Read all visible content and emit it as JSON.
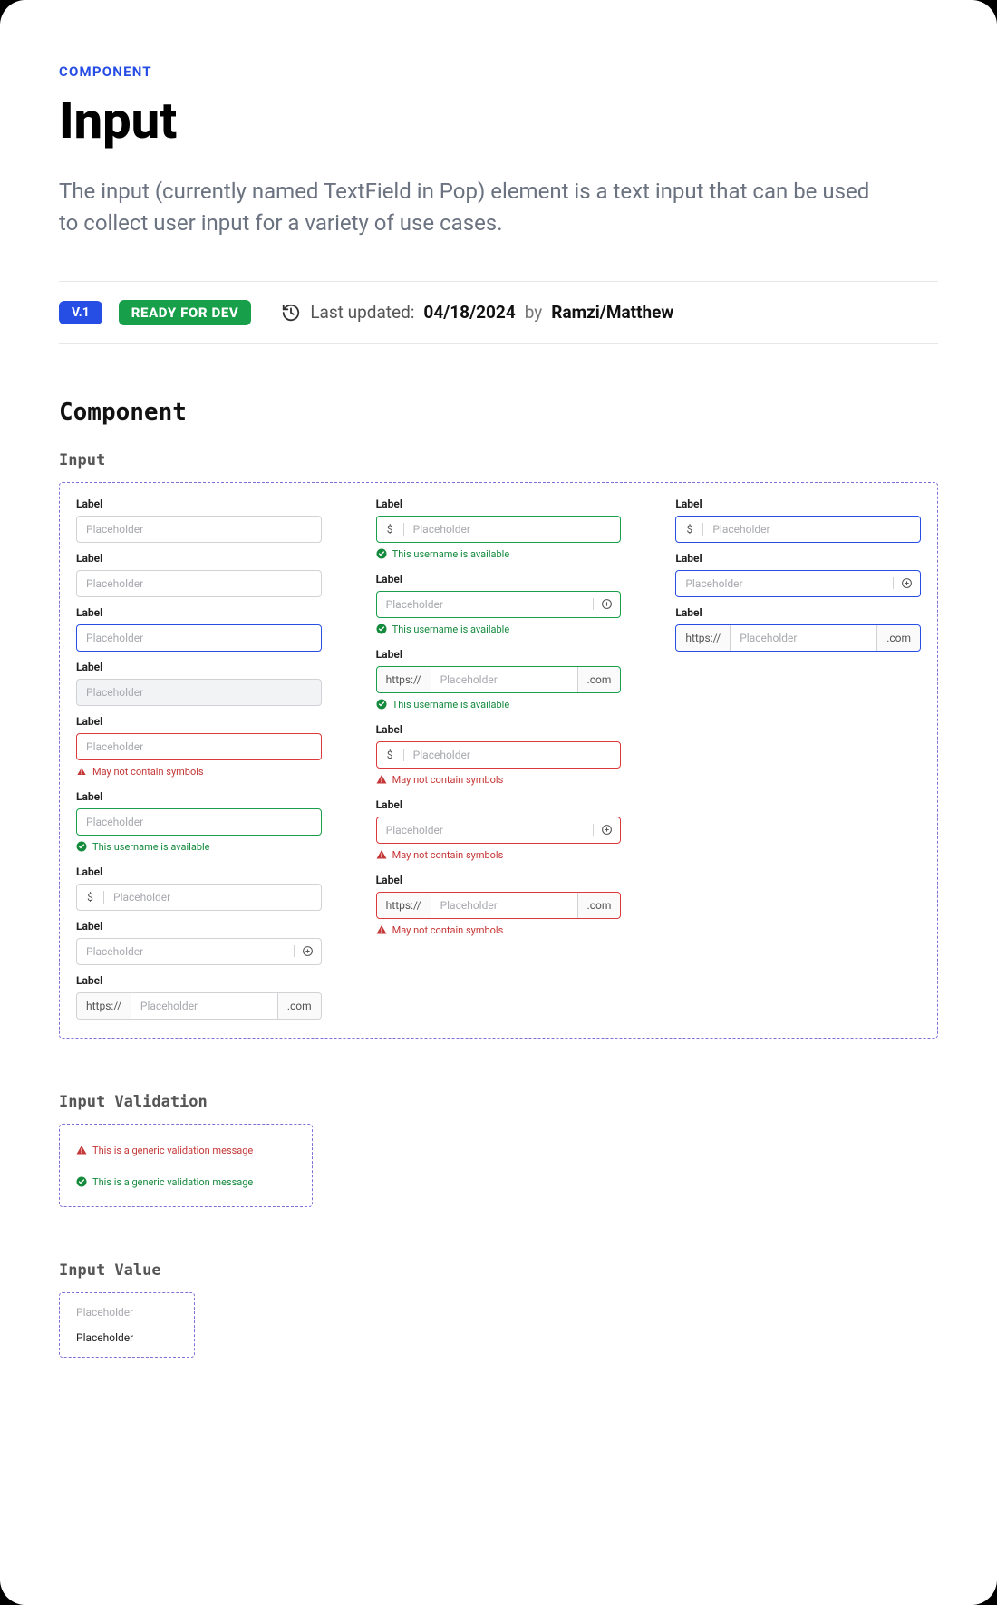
{
  "eyebrow": "COMPONENT",
  "title": "Input",
  "description": "The input (currently named TextField in Pop) element is a text input that can be used to collect user input for a variety of use cases.",
  "badges": {
    "version": "V.1",
    "status": "READY FOR DEV"
  },
  "meta": {
    "updated_label": "Last updated:",
    "date": "04/18/2024",
    "by_label": "by",
    "authors": "Ramzi/Matthew"
  },
  "section_component": "Component",
  "section_input": "Input",
  "section_validation": "Input Validation",
  "section_value": "Input Value",
  "common": {
    "label": "Label",
    "placeholder": "Placeholder",
    "success_msg": "This username is available",
    "error_msg": "May not contain symbols",
    "prefix_https": "https://",
    "suffix_com": ".com",
    "dollar": "$"
  },
  "validation": {
    "error": "This is a generic validation message",
    "success": "This is a generic validation message"
  },
  "value_box": {
    "placeholder": "Placeholder",
    "filled": "Placeholder"
  }
}
